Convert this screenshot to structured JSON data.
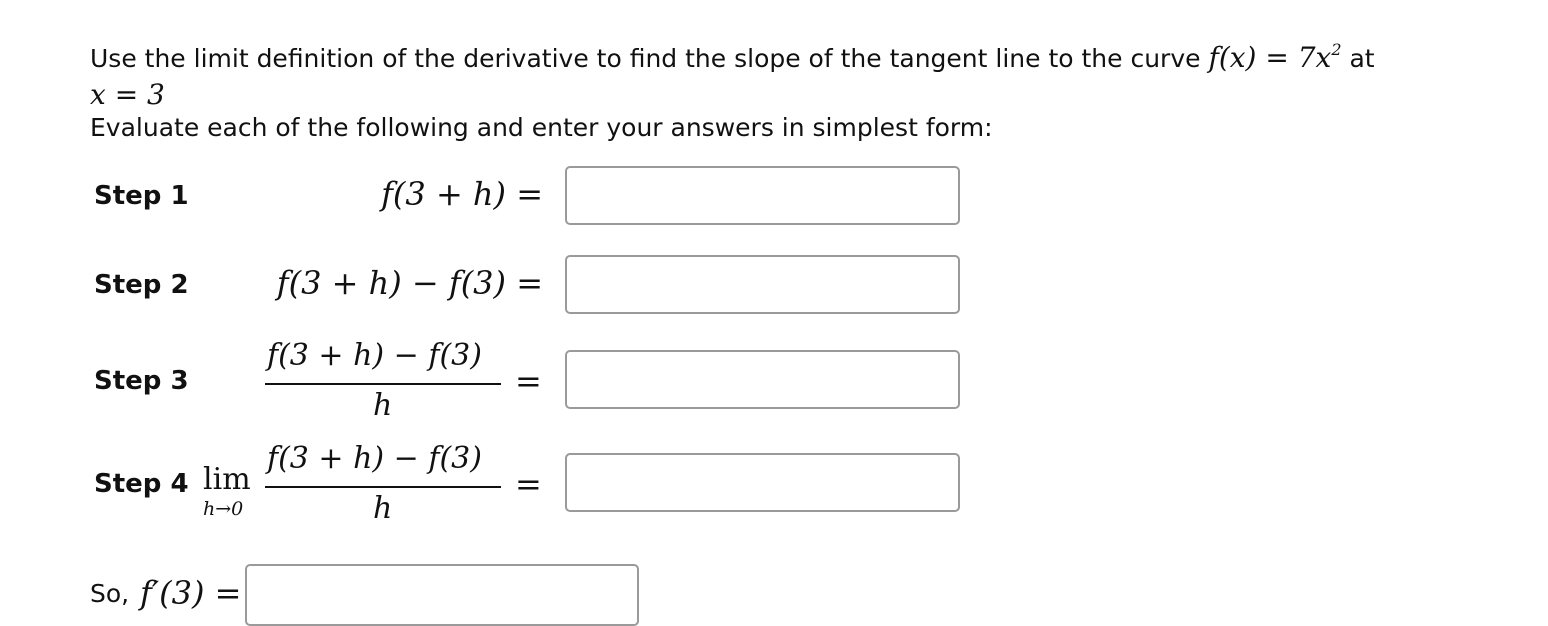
{
  "intro": {
    "line1_prefix": "Use the limit definition of the derivative to find the slope of the tangent line to the curve",
    "function_expr": "f(x) = 7x",
    "function_exp": "2",
    "line1_suffix": "at",
    "point_expr": "x = 3",
    "line2": "Evaluate each of the following and enter your answers in simplest form:"
  },
  "steps": [
    {
      "label": "Step 1",
      "expression": "f(3 + h) =",
      "answer": ""
    },
    {
      "label": "Step 2",
      "expression": "f(3 + h) − f(3) =",
      "answer": ""
    },
    {
      "label": "Step 3",
      "numerator": "f(3 + h) − f(3)",
      "denominator": "h",
      "equals": "=",
      "answer": ""
    },
    {
      "label": "Step 4",
      "limit_word": "lim",
      "limit_sub": "h→0",
      "numerator": "f(3 + h) − f(3)",
      "denominator": "h",
      "equals": "=",
      "answer": ""
    }
  ],
  "conclusion": {
    "label": "So,",
    "expression": "f′(3) =",
    "answer": ""
  }
}
